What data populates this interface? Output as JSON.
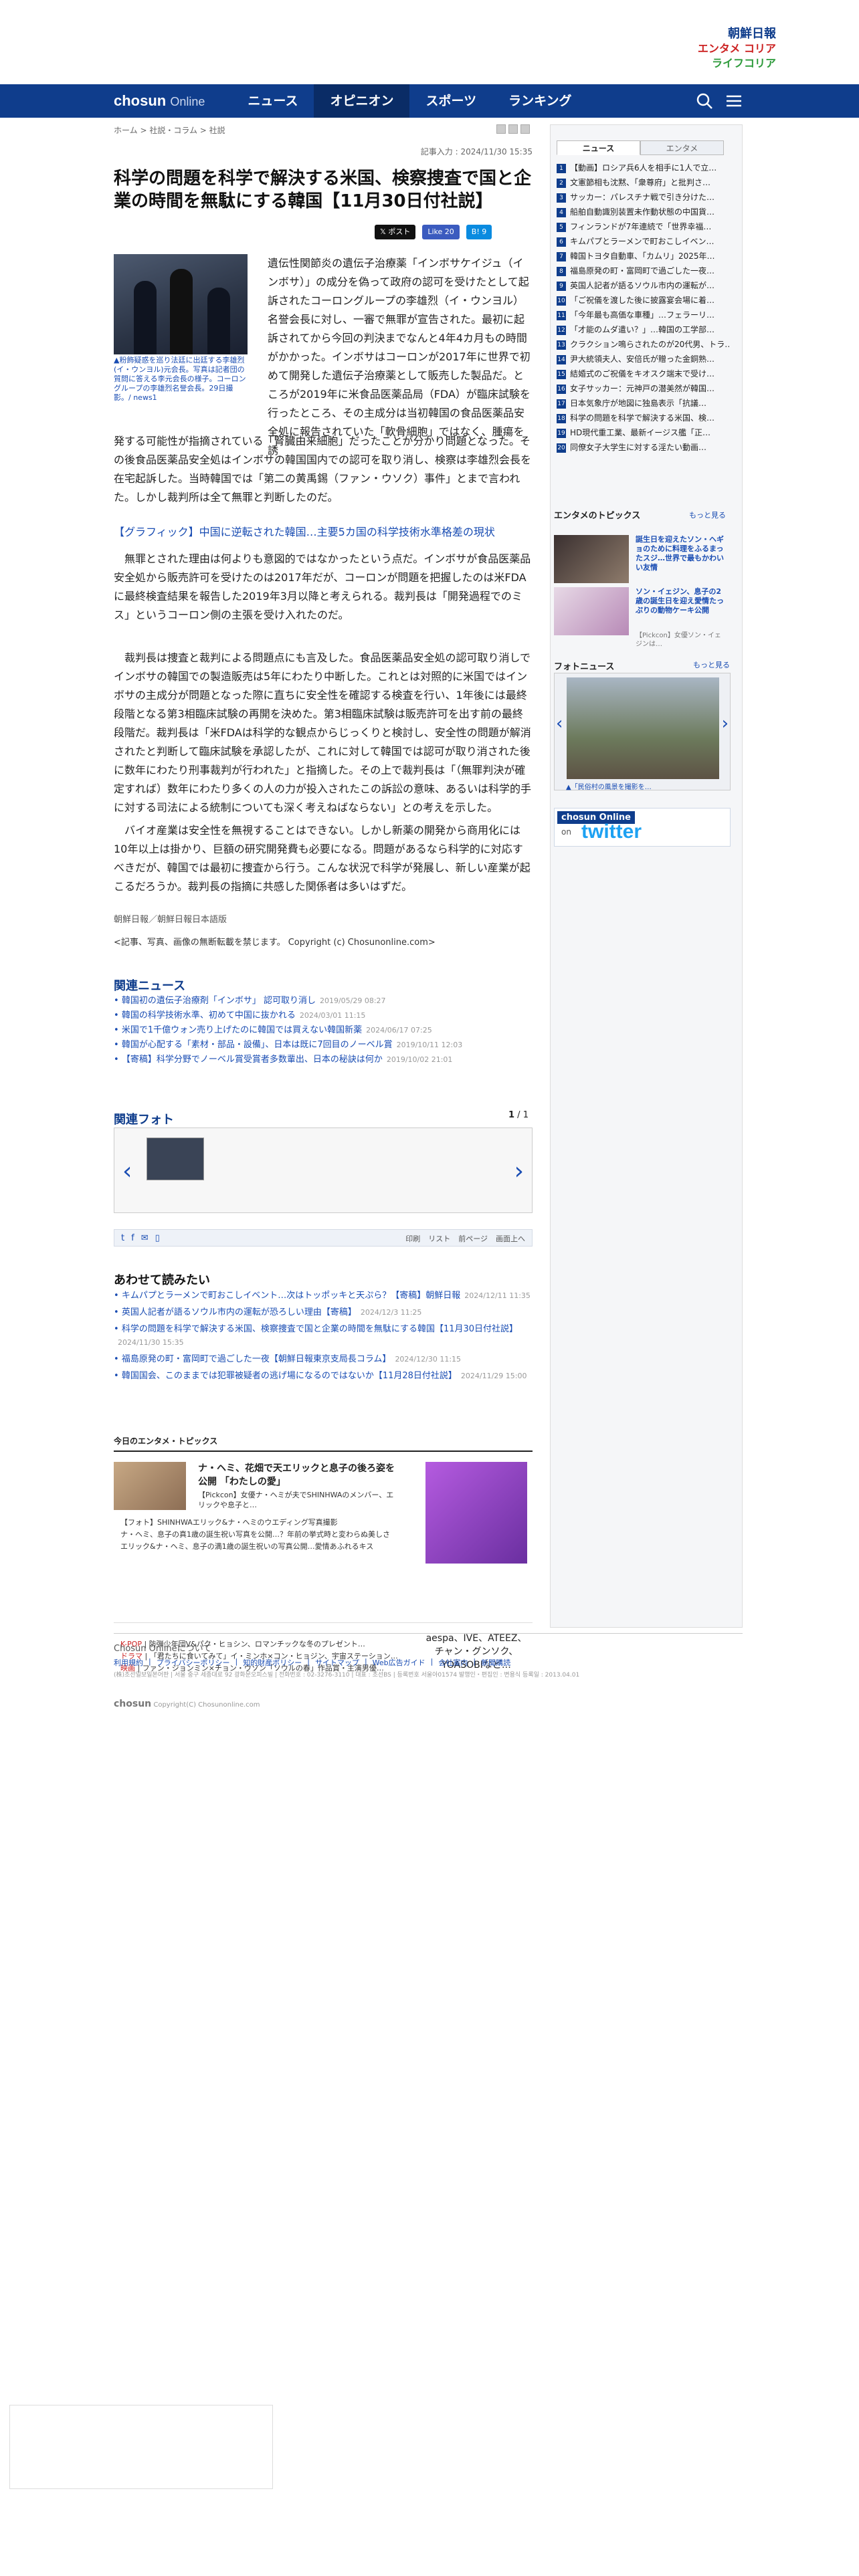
{
  "header": {
    "logo_line1": "朝鮮日報",
    "logo_line2": "エンタメ コリア",
    "logo_line3": "ライフコリア",
    "brand_name": "chosun",
    "brand_suffix": "Online",
    "nav": [
      "ニュース",
      "オピニオン",
      "スポーツ",
      "ランキング"
    ],
    "active_nav": "オピニオン"
  },
  "breadcrumb": [
    "ホーム",
    "社説・コラム",
    "社説"
  ],
  "article": {
    "dateline": "記事入力 : 2024/11/30 15:35",
    "title": "科学の問題を科学で解決する米国、検察捜査で国と企業の時間を無駄にする韓国【11月30日付社説】",
    "share": {
      "x_post": "𝕏 ポスト",
      "fb_like": "Like 20",
      "hatena": "B! 9"
    },
    "photo_caption": "▲粉飾疑惑を巡り法廷に出廷する李雄烈(イ・ウンヨル)元会長。写真は記者団の質問に答える李元会長の様子。コーロングループの李雄烈名誉会長。29日撮影。/ news1",
    "para1_right": "遺伝性関節炎の遺伝子治療薬「インボサケイジュ（インボサ）」の成分を偽って政府の認可を受けたとして起訴されたコーロングループの李雄烈（イ・ウンヨル）名誉会長に対し、一審で無罪が宣告された。最初に起訴されてから今回の判決までなんと4年4カ月もの時間がかかった。インボサはコーロンが2017年に世界で初めて開発した遺伝子治療薬として販売した製品だ。ところが2019年に米食品医薬品局（FDA）が臨床試験を行ったところ、その主成分は当初韓国の食品医薬品安全処に報告されていた「軟骨細胞」ではなく、腫瘍を誘",
    "para1_full": "発する可能性が指摘されている「腎臓由来細胞」だったことが分かり問題となった。その後食品医薬品安全処はインボサの韓国国内での認可を取り消し、検察は李雄烈会長を在宅起訴した。当時韓国では「第二の黄禹錫（ファン・ウソク）事件」とまで言われた。しかし裁判所は全て無罪と判断したのだ。",
    "graphic_link": "【グラフィック】中国に逆転された韓国…主要5カ国の科学技術水準格差の現状",
    "para2": "無罪とされた理由は何よりも意図的ではなかったという点だ。インボサが食品医薬品安全処から販売許可を受けたのは2017年だが、コーロンが問題を把握したのは米FDAに最終検査結果を報告した2019年3月以降と考えられる。裁判長は「開発過程でのミス」というコーロン側の主張を受け入れたのだ。",
    "para3": "裁判長は捜査と裁判による問題点にも言及した。食品医薬品安全処の認可取り消しでインボサの韓国での製造販売は5年にわたり中断した。これとは対照的に米国ではインボサの主成分が問題となった際に直ちに安全性を確認する検査を行い、1年後には最終段階となる第3相臨床試験の再開を決めた。第3相臨床試験は販売許可を出す前の最終段階だ。裁判長は「米FDAは科学的な観点からじっくりと検討し、安全性の問題が解消されたと判断して臨床試験を承認したが、これに対して韓国では認可が取り消された後に数年にわたり刑事裁判が行われた」と指摘した。その上で裁判長は「（無罪判決が確定すれば）数年にわたり多くの人の力が投入されたこの訴訟の意味、あるいは科学的手に対する司法による統制についても深く考えねばならない」との考えを示した。",
    "para4": "バイオ産業は安全性を無視することはできない。しかし新薬の開発から商用化には10年以上は掛かり、巨額の研究開発費も必要になる。問題があるなら科学的に対応すべきだが、韓国では最初に捜査から行う。こんな状況で科学が発展し、新しい産業が起こるだろうか。裁判長の指摘に共感した関係者は多いはずだ。",
    "source": "朝鮮日報／朝鮮日報日本語版",
    "copyright": "<記事、写真、画像の無断転載を禁じます。 Copyright (c) Chosunonline.com>"
  },
  "related_news": {
    "heading": "関連ニュース",
    "items": [
      {
        "title": "韓国初の遺伝子治療剤「インボサ」 認可取り消し",
        "date": "2019/05/29 08:27"
      },
      {
        "title": "韓国の科学技術水準、初めて中国に抜かれる",
        "date": "2024/03/01 11:15"
      },
      {
        "title": "米国で1千億ウォン売り上げたのに韓国では買えない韓国新薬",
        "date": "2024/06/17 07:25"
      },
      {
        "title": "韓国が心配する「素材・部品・設備」、日本は既に7回目のノーベル賞",
        "date": "2019/10/11 12:03"
      },
      {
        "title": "【寄稿】科学分野でノーベル賞受賞者多数輩出、日本の秘訣は何か",
        "date": "2019/10/02 21:01"
      }
    ]
  },
  "related_photos": {
    "heading": "関連フォト",
    "count_current": "1",
    "count_total": "1"
  },
  "tools": {
    "left": [
      "t",
      "f",
      "✉",
      "▯"
    ],
    "right": [
      "印刷",
      "リスト",
      "前ページ",
      "画面上へ"
    ]
  },
  "also_read": {
    "heading": "あわせて読みたい",
    "items": [
      {
        "title": "キムパプとラーメンで町おこしイベント…次はトッポッキと天ぷら？【寄稿】朝鮮日報",
        "date": "2024/12/11 11:35"
      },
      {
        "title": "英国人記者が語るソウル市内の運転が恐ろしい理由【寄稿】",
        "date": "2024/12/3 11:25"
      },
      {
        "title": "科学の問題を科学で解決する米国、検察捜査で国と企業の時間を無駄にする韓国【11月30日付社説】",
        "date": "2024/11/30 15:35"
      },
      {
        "title": "福島原発の町・富岡町で過ごした一夜【朝鮮日報東京支局長コラム】",
        "date": "2024/12/30 11:15"
      },
      {
        "title": "韓国国会、このままでは犯罪被疑者の逃げ場になるのではないか【11月28日付社説】",
        "date": "2024/11/29 15:00"
      }
    ]
  },
  "entertainment": {
    "heading": "今日のエンタメ・トピックス",
    "main_title": "ナ・ヘミ、花畑で天エリックと息子の後ろ姿を公開 「わたしの愛」",
    "main_sub": "【Pickcon】女優ナ・ヘミが夫でSHINHWAのメンバー、エリックや息子と…",
    "lines": [
      "【フォト】SHINHWAエリック&ナ・ヘミのウエディング写真撮影",
      "ナ・ヘミ、息子の真1歳の誕生祝い写真を公開…？年前の挙式時と変わらぬ美しさ",
      "エリック&ナ・ヘミ、息子の満1歳の誕生祝いの写真公開…愛情あふれるキス"
    ],
    "kpop": [
      {
        "tag": "K-POP",
        "text": "防弾少年団V&パク・ヒョシン、ロマンチックな冬のプレゼント…"
      },
      {
        "tag": "ドラマ",
        "text": "「君たちに食いてみて」イ・ミンホ×コン・ヒョジン、宇宙ステーション…"
      },
      {
        "tag": "映画",
        "text": "ファン・ジョンミン×チョン・ウソン「ソウルの春」作品賞・主演男優…"
      }
    ],
    "side_caption": "aespa、IVE、ATEEZ、チャン・グンソク、YOASOBIなど…"
  },
  "sidebar": {
    "tabs": [
      "ニュース",
      "エンタメ"
    ],
    "ranking": [
      "【動画】ロシア兵6人を相手に1人で立…",
      "文憲節相も沈黙、「衆尊府」と批判さ…",
      "サッカー：パレスチナ戦で引き分けた…",
      "船舶自動識別装置未作動状態の中国貨…",
      "フィンランドが7年連続で「世界幸福…",
      "キムパプとラーメンで町おこしイベン…",
      "韓国トヨタ自動車、「カムリ」2025年…",
      "福島原発の町・富岡町で過ごした一夜…",
      "英国人記者が語るソウル市内の運転が…",
      "「ご祝儀を渡した後に披露宴会場に着…",
      "「今年最も高価な車種」…フェラーリ…",
      "「才能のムダ遣い？」…韓国の工学部…",
      "クラクション鳴らされたのが20代男、トラ…",
      "尹大統領夫人、安倍氏が贈った金銅熟…",
      "結婚式のご祝儀をキオスク端末で受け…",
      "女子サッカー：元神戸の潜美然が韓国…",
      "日本気象庁が地図に独島表示「抗議…",
      "科学の問題を科学で解決する米国、検…",
      "HD現代重工業、最新イージス艦「正…",
      "同僚女子大学生に対する淫たい動画…"
    ],
    "topics_heading": "エンタメのトピックス",
    "more": "もっと見る",
    "topic1": "誕生日を迎えたソン・ヘギョのために料理をふるまったスジ…世界で最もかわいい友情",
    "topic2": "ソン・イェジン、息子の2歳の誕生日を迎え愛情たっぷりの動物ケーキ公開",
    "topic2_caption": "【Pickcon】女優ソン・イェジンは…",
    "photo_news_heading": "フォトニュース",
    "photo_news_caption": "▲「民俗村の風景を撮影を…",
    "twitter": {
      "top": "chosun Online",
      "on": "on",
      "bird": "twitter"
    }
  },
  "footer": {
    "about": "Chosun Onlineについて",
    "links": [
      "利用規約",
      "プライバシーポリシー",
      "知的財産ポリシー",
      "サイトマップ",
      "Web広告ガイド",
      "会社案内",
      "新聞購読"
    ],
    "address": "(株)조선일보일본어판 | 서울 중구 세종대로 92 광화문오피스빌 | 전화번호 : 02-3276-3110 | 대표 : 조선BS | 등록번호 서울아01574 발행인・편집인 : 변용식 등록일 : 2013.04.01",
    "copy_brand": "chosun",
    "copy_text": "Copyright(C) Chosunonline.com"
  }
}
